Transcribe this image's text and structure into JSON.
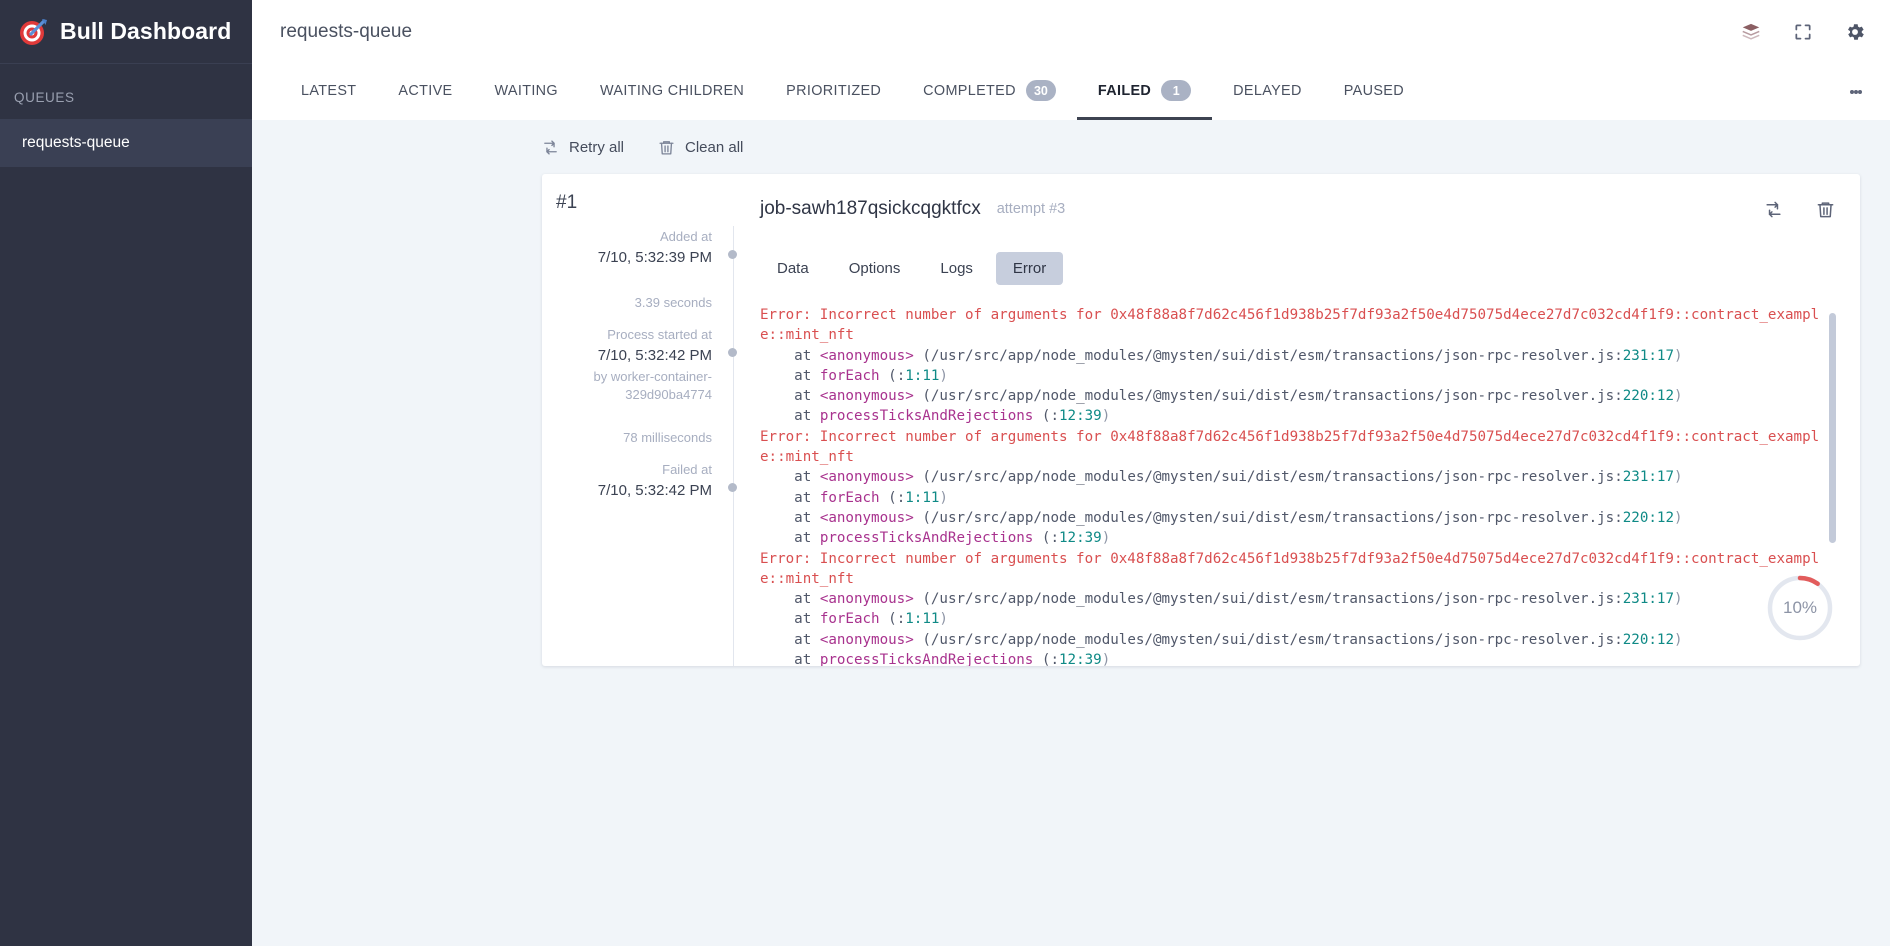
{
  "sidebar": {
    "brand": "Bull Dashboard",
    "brand_logo_icon": "target-dart-icon",
    "section_label": "QUEUES",
    "queues": [
      {
        "name": "requests-queue"
      }
    ]
  },
  "topbar": {
    "title": "requests-queue",
    "actions": [
      {
        "name": "redis-icon",
        "label": "Redis"
      },
      {
        "name": "fullscreen-icon",
        "label": "Fullscreen"
      },
      {
        "name": "gear-icon",
        "label": "Settings"
      }
    ]
  },
  "tabs": [
    {
      "label": "LATEST",
      "count": null,
      "active": false
    },
    {
      "label": "ACTIVE",
      "count": null,
      "active": false
    },
    {
      "label": "WAITING",
      "count": null,
      "active": false
    },
    {
      "label": "WAITING CHILDREN",
      "count": null,
      "active": false
    },
    {
      "label": "PRIORITIZED",
      "count": null,
      "active": false
    },
    {
      "label": "COMPLETED",
      "count": "30",
      "active": false
    },
    {
      "label": "FAILED",
      "count": "1",
      "active": true
    },
    {
      "label": "DELAYED",
      "count": null,
      "active": false
    },
    {
      "label": "PAUSED",
      "count": null,
      "active": false
    }
  ],
  "toolbar": {
    "retry_all_label": "Retry all",
    "clean_all_label": "Clean all"
  },
  "job": {
    "index_label": "#1",
    "id": "job-sawh187qsickcqgktfcx",
    "attempt": "attempt #3",
    "progress_percent": "10%",
    "progress_value": 10,
    "progress_color": "#e25c5c",
    "timeline": {
      "added_label": "Added at",
      "added_value": "7/10, 5:32:39 PM",
      "gap_1": "3.39 seconds",
      "process_started_label": "Process started at",
      "process_started_value": "7/10, 5:32:42 PM",
      "worker_line_1": "by worker-container-",
      "worker_line_2": "329d90ba4774",
      "gap_2": "78 milliseconds",
      "failed_label": "Failed at",
      "failed_value": "7/10, 5:32:42 PM"
    },
    "tabs": [
      {
        "label": "Data",
        "active": false
      },
      {
        "label": "Options",
        "active": false
      },
      {
        "label": "Logs",
        "active": false
      },
      {
        "label": "Error",
        "active": true
      }
    ],
    "error": {
      "message_prefix": "Error:",
      "message_body": " Incorrect number of arguments for 0x48f88a8f7d62c456f1d938b25f7df93a2f50e4d75075d4ece27d7c032cd4f1f9::contract_exampl",
      "message_cont": "e::mint_nft",
      "frames": [
        {
          "at": "at",
          "fn": "<anonymous>",
          "path": " (/usr/src/app/node_modules/@mysten/sui/dist/esm/transactions/json-rpc-resolver.js:",
          "loc": "231:17",
          "close": ")"
        },
        {
          "at": "at",
          "fn": "forEach",
          "path": " (:",
          "loc": "1:11",
          "close": ")"
        },
        {
          "at": "at",
          "fn": "<anonymous>",
          "path": " (/usr/src/app/node_modules/@mysten/sui/dist/esm/transactions/json-rpc-resolver.js:",
          "loc": "220:12",
          "close": ")"
        },
        {
          "at": "at",
          "fn": "processTicksAndRejections",
          "path": " (:",
          "loc": "12:39",
          "close": ")"
        }
      ],
      "repeat_count": 3
    }
  }
}
